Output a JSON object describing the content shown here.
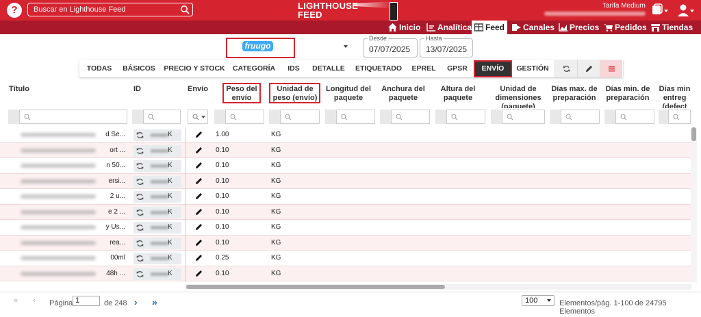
{
  "topbar": {
    "search_placeholder": "Buscar en Lighthouse Feed",
    "logo_line1": "LIGHTHOUSE",
    "logo_line2": "FEED",
    "plan": "Tarifa Medium"
  },
  "nav": [
    {
      "label": "Inicio",
      "icon": "home-icon"
    },
    {
      "label": "Analítica",
      "icon": "chart-icon"
    },
    {
      "label": "Feed",
      "icon": "table-icon",
      "active": true
    },
    {
      "label": "Canales",
      "icon": "export-icon"
    },
    {
      "label": "Precios",
      "icon": "area-chart-icon"
    },
    {
      "label": "Pedidos",
      "icon": "cart-icon"
    },
    {
      "label": "Tiendas",
      "icon": "store-icon"
    }
  ],
  "store": {
    "name": "fruugo"
  },
  "dates": {
    "desde_label": "Desde",
    "desde": "07/07/2025",
    "hasta_label": "Hasta",
    "hasta": "13/07/2025"
  },
  "tabs": [
    "TODAS",
    "BÁSICOS",
    "PRECIO Y STOCK",
    "CATEGORÍA",
    "IDS",
    "DETALLE",
    "ETIQUETADO",
    "EPREL",
    "GPSR",
    "ENVÍO",
    "GESTIÓN"
  ],
  "columns": {
    "titulo": "Título",
    "id": "ID",
    "envio": "Envío",
    "peso": [
      "Peso del",
      "envío"
    ],
    "unidad": [
      "Unidad de",
      "peso (envío)"
    ],
    "longitud": [
      "Longitud del",
      "paquete"
    ],
    "anchura": [
      "Anchura del",
      "paquete"
    ],
    "altura": [
      "Altura del",
      "paquete"
    ],
    "unidad_dim": [
      "Unidad de",
      "dimensiones",
      "(paquete)"
    ],
    "dias_max": [
      "Días max. de",
      "preparación"
    ],
    "dias_min": [
      "Días min. de",
      "preparación"
    ],
    "dias_min_ent": [
      "Días min",
      "entreg",
      "(defect"
    ]
  },
  "rows": [
    {
      "title_tail": "d Se...",
      "id_tail": "K",
      "peso": "1.00",
      "unidad": "KG"
    },
    {
      "title_tail": "ort ...",
      "id_tail": "K",
      "peso": "0.10",
      "unidad": "KG"
    },
    {
      "title_tail": "n 50...",
      "id_tail": "K",
      "peso": "0.10",
      "unidad": "KG"
    },
    {
      "title_tail": "ersi...",
      "id_tail": "K",
      "peso": "0.10",
      "unidad": "KG"
    },
    {
      "title_tail": "2 u...",
      "id_tail": "K",
      "peso": "0.10",
      "unidad": "KG"
    },
    {
      "title_tail": "e 2 ...",
      "id_tail": "K",
      "peso": "0.10",
      "unidad": "KG"
    },
    {
      "title_tail": "y Us...",
      "id_tail": "K",
      "peso": "0.10",
      "unidad": "KG"
    },
    {
      "title_tail": "rea...",
      "id_tail": "K",
      "peso": "0.10",
      "unidad": "KG"
    },
    {
      "title_tail": "00ml",
      "id_tail": "K",
      "peso": "0.25",
      "unidad": "KG"
    },
    {
      "title_tail": "48h ...",
      "id_tail": "K",
      "peso": "0.10",
      "unidad": "KG"
    }
  ],
  "footer": {
    "page_label": "Página",
    "page_value": "1",
    "of_label": "de 248",
    "page_size": "100",
    "summary": "Elementos/pág. 1-100 de 24795 Elementos"
  }
}
